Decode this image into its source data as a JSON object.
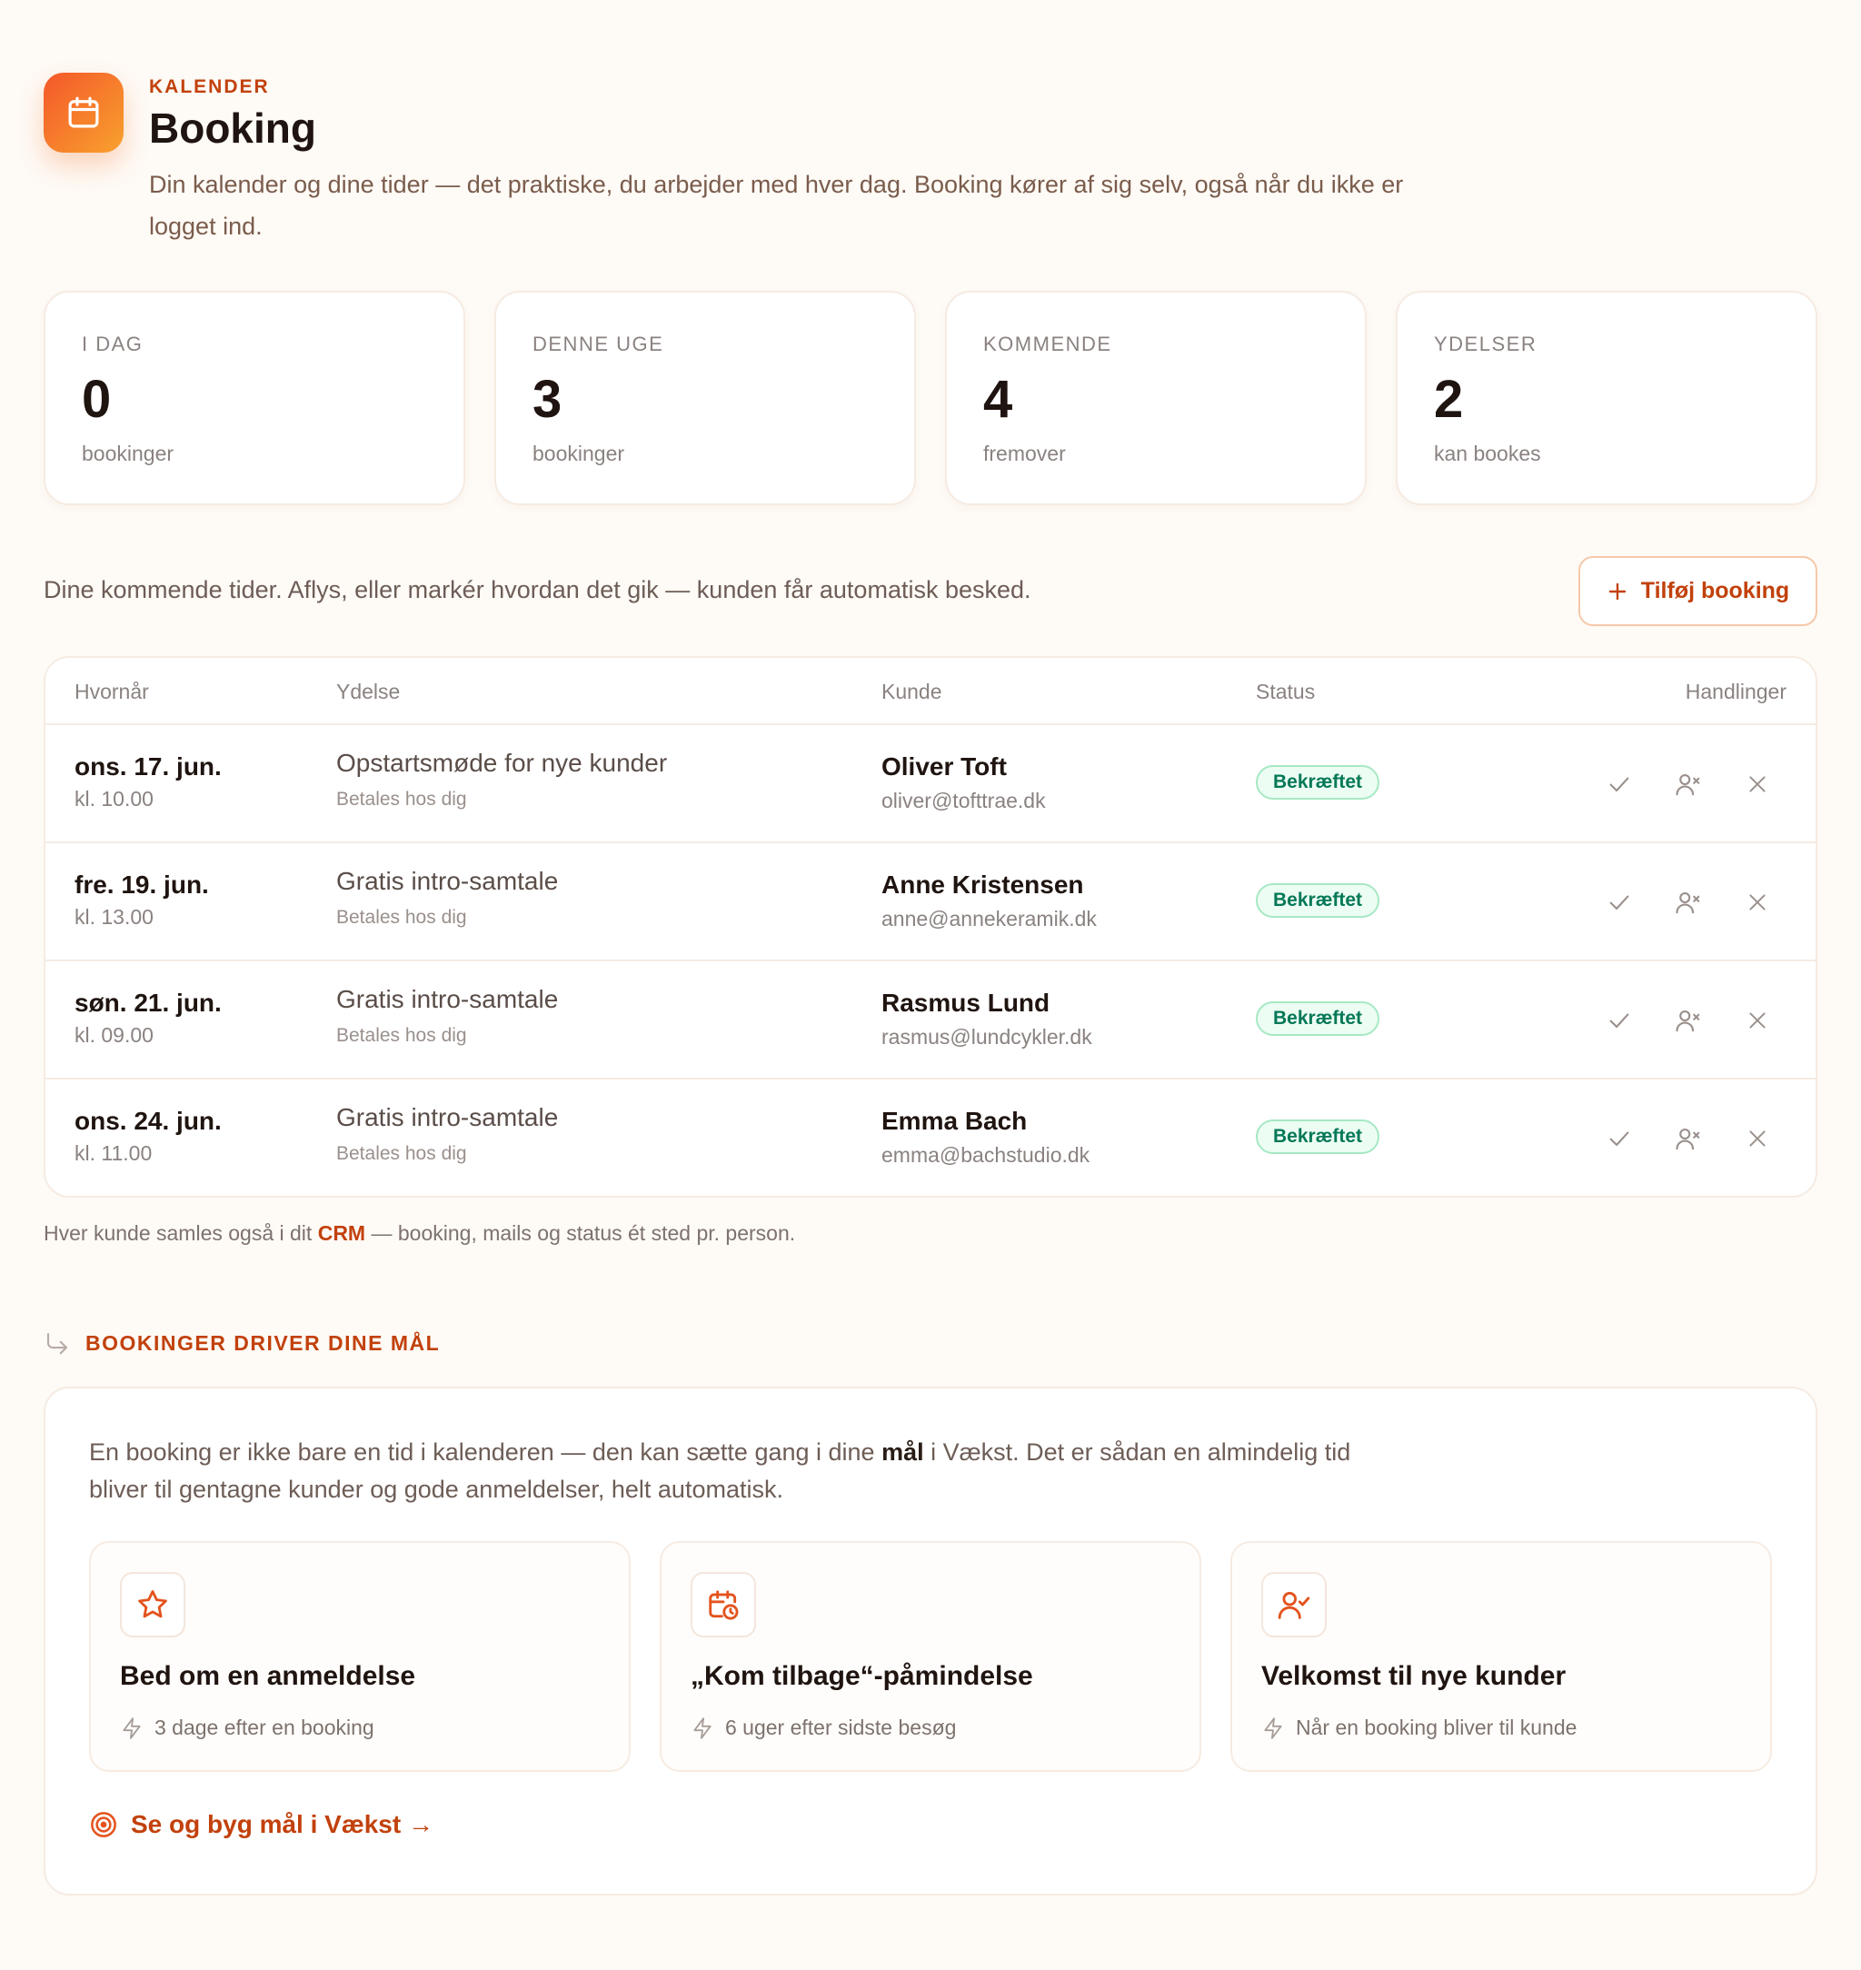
{
  "header": {
    "eyebrow": "KALENDER",
    "title": "Booking",
    "intro": "Din kalender og dine tider — det praktiske, du arbejder med hver dag. Booking kører af sig selv, også når du ikke er logget ind."
  },
  "stats": [
    {
      "label": "I DAG",
      "value": "0",
      "sub": "bookinger"
    },
    {
      "label": "DENNE UGE",
      "value": "3",
      "sub": "bookinger"
    },
    {
      "label": "KOMMENDE",
      "value": "4",
      "sub": "fremover"
    },
    {
      "label": "YDELSER",
      "value": "2",
      "sub": "kan bookes"
    }
  ],
  "toolbar": {
    "text": "Dine kommende tider. Aflys, eller markér hvordan det gik — kunden får automatisk besked.",
    "add_label": "Tilføj booking"
  },
  "table": {
    "columns": [
      "Hvornår",
      "Ydelse",
      "Kunde",
      "Status",
      "Handlinger"
    ],
    "rows": [
      {
        "date": "ons. 17. jun.",
        "time": "kl. 10.00",
        "service": "Opstartsmøde for nye kunder",
        "payment": "Betales hos dig",
        "customer": "Oliver Toft",
        "email": "oliver@tofttrae.dk",
        "status": "Bekræftet"
      },
      {
        "date": "fre. 19. jun.",
        "time": "kl. 13.00",
        "service": "Gratis intro-samtale",
        "payment": "Betales hos dig",
        "customer": "Anne Kristensen",
        "email": "anne@annekeramik.dk",
        "status": "Bekræftet"
      },
      {
        "date": "søn. 21. jun.",
        "time": "kl. 09.00",
        "service": "Gratis intro-samtale",
        "payment": "Betales hos dig",
        "customer": "Rasmus Lund",
        "email": "rasmus@lundcykler.dk",
        "status": "Bekræftet"
      },
      {
        "date": "ons. 24. jun.",
        "time": "kl. 11.00",
        "service": "Gratis intro-samtale",
        "payment": "Betales hos dig",
        "customer": "Emma Bach",
        "email": "emma@bachstudio.dk",
        "status": "Bekræftet"
      }
    ]
  },
  "footnote": {
    "before": "Hver kunde samles også i dit ",
    "link": "CRM",
    "after": " — booking, mails og status ét sted pr. person."
  },
  "goals": {
    "eyebrow": "BOOKINGER DRIVER DINE MÅL",
    "text_before": "En booking er ikke bare en tid i kalenderen — den kan sætte gang i dine ",
    "text_bold": "mål",
    "text_after": " i Vækst. Det er sådan en almindelig tid bliver til gentagne kunder og gode anmeldelser, helt automatisk.",
    "cards": [
      {
        "icon": "star-icon",
        "title": "Bed om en anmeldelse",
        "sub": "3 dage efter en booking"
      },
      {
        "icon": "calendar-clock-icon",
        "title": "„Kom tilbage“-påmindelse",
        "sub": "6 uger efter sidste besøg"
      },
      {
        "icon": "user-check-icon",
        "title": "Velkomst til nye kunder",
        "sub": "Når en booking bliver til kunde"
      }
    ],
    "link_label": "Se og byg mål i Vækst →"
  },
  "colors": {
    "accent": "#c2410c",
    "background": "#fefaf5",
    "status_green": "#047857"
  }
}
